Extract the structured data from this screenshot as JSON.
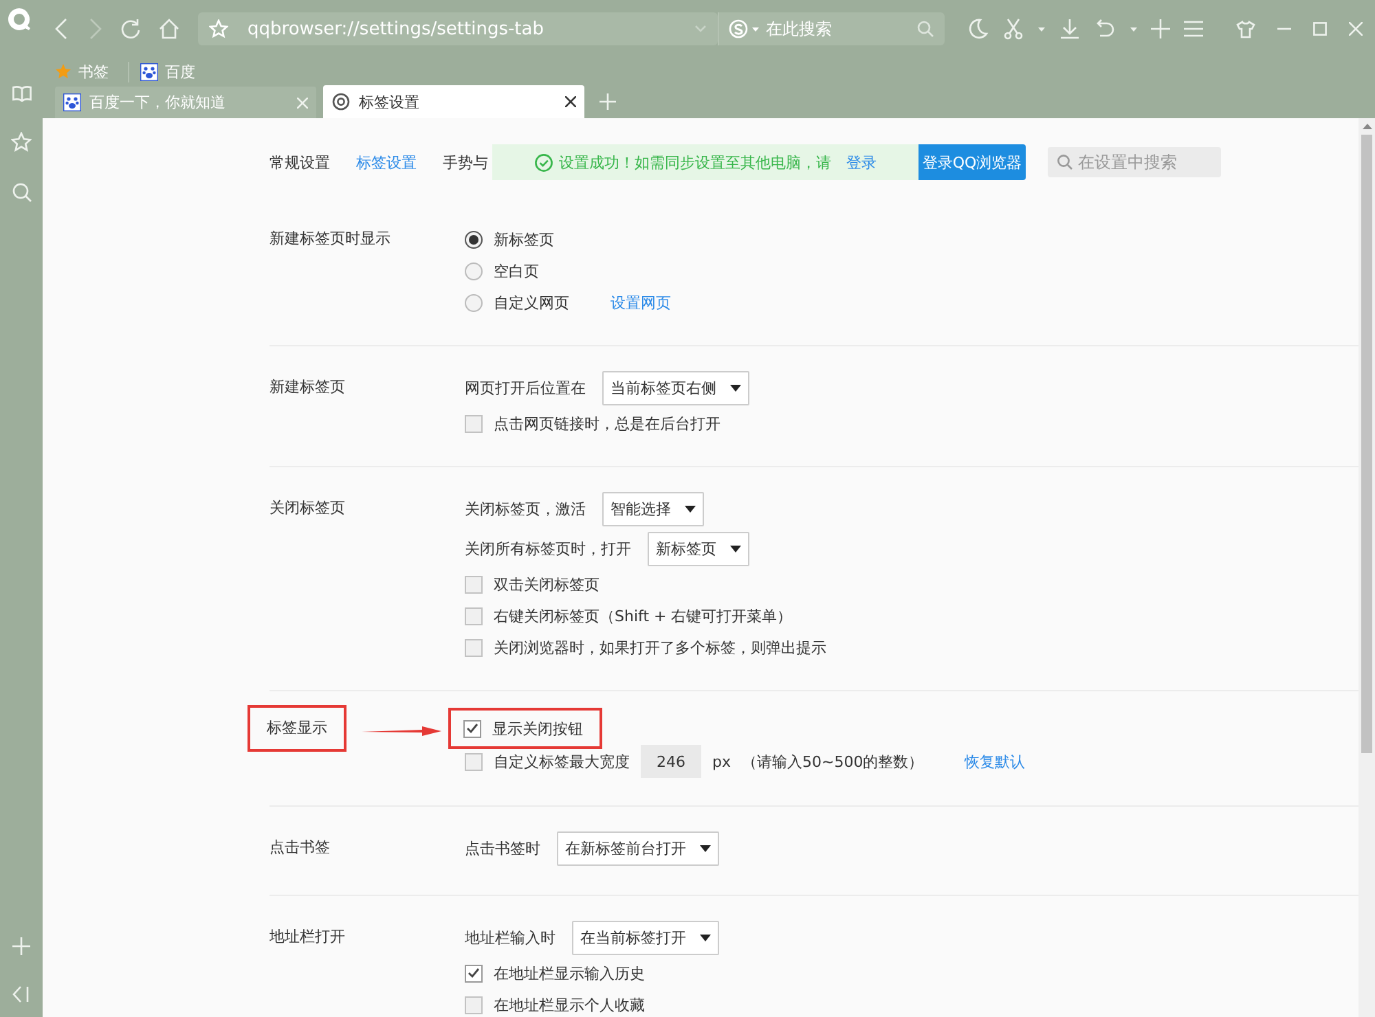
{
  "toolbar": {
    "address": "qqbrowser://settings/settings-tab",
    "search_placeholder": "在此搜索"
  },
  "bookmarks": [
    {
      "label": "书签",
      "kind": "star"
    },
    {
      "label": "百度",
      "kind": "paw"
    }
  ],
  "tabs": [
    {
      "title": "百度一下，你就知道",
      "kind": "paw",
      "selected": false
    },
    {
      "title": "标签设置",
      "kind": "gear",
      "selected": true
    }
  ],
  "settings_nav": [
    {
      "label": "常规设置",
      "selected": false
    },
    {
      "label": "标签设置",
      "selected": true
    },
    {
      "label": "手势与",
      "selected": false
    }
  ],
  "toast": {
    "message": "设置成功！如需同步设置至其他电脑，请",
    "link": "登录"
  },
  "login_button": "登录QQ浏览器",
  "settings_search": {
    "placeholder": "在设置中搜索"
  },
  "sections": [
    {
      "label": "新建标签页时显示",
      "highlighted": false,
      "arrow": false,
      "rows": [
        {
          "kind": "radio",
          "label": "新标签页",
          "selected": true
        },
        {
          "kind": "radio",
          "label": "空白页",
          "selected": false
        },
        {
          "kind": "radio",
          "label": "自定义网页",
          "selected": false,
          "link": "设置网页"
        }
      ]
    },
    {
      "label": "新建标签页",
      "highlighted": false,
      "arrow": false,
      "rows": [
        {
          "kind": "select",
          "label": "网页打开后位置在",
          "value": "当前标签页右侧"
        },
        {
          "kind": "checkbox",
          "label": "点击网页链接时，总是在后台打开",
          "checked": false,
          "highlighted": false
        }
      ]
    },
    {
      "label": "关闭标签页",
      "highlighted": false,
      "arrow": false,
      "rows": [
        {
          "kind": "select",
          "label": "关闭标签页，激活",
          "value": "智能选择"
        },
        {
          "kind": "select",
          "label": "关闭所有标签页时，打开",
          "value": "新标签页"
        },
        {
          "kind": "checkbox",
          "label": "双击关闭标签页",
          "checked": false,
          "highlighted": false
        },
        {
          "kind": "checkbox",
          "label": "右键关闭标签页（Shift + 右键可打开菜单）",
          "checked": false,
          "highlighted": false
        },
        {
          "kind": "checkbox",
          "label": "关闭浏览器时，如果打开了多个标签，则弹出提示",
          "checked": false,
          "highlighted": false
        }
      ]
    },
    {
      "label": "标签显示",
      "highlighted": true,
      "arrow": true,
      "rows": [
        {
          "kind": "checkbox",
          "label": "显示关闭按钮",
          "checked": true,
          "highlighted": true
        },
        {
          "kind": "width",
          "label": "自定义标签最大宽度",
          "checked": false,
          "value": "246",
          "unit": "px",
          "hint": "（请输入50~500的整数）",
          "link": "恢复默认"
        }
      ]
    },
    {
      "label": "点击书签",
      "highlighted": false,
      "arrow": false,
      "rows": [
        {
          "kind": "select",
          "label": "点击书签时",
          "value": "在新标签前台打开"
        }
      ]
    },
    {
      "label": "地址栏打开",
      "highlighted": false,
      "arrow": false,
      "rows": [
        {
          "kind": "select",
          "label": "地址栏输入时",
          "value": "在当前标签打开"
        },
        {
          "kind": "checkbox",
          "label": "在地址栏显示输入历史",
          "checked": true,
          "highlighted": false
        },
        {
          "kind": "checkbox",
          "label": "在地址栏显示个人收藏",
          "checked": false,
          "highlighted": false
        }
      ]
    }
  ]
}
